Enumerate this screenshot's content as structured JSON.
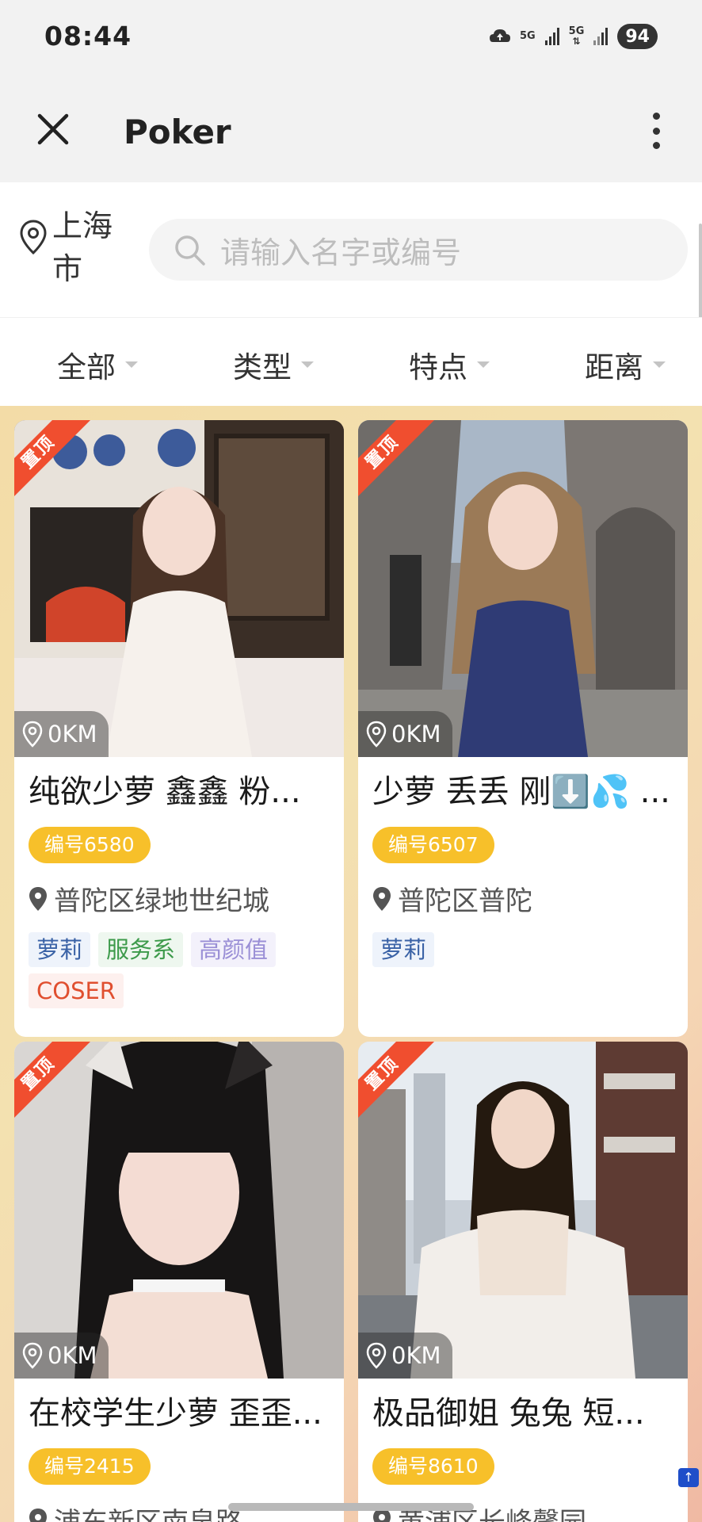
{
  "status_bar": {
    "time": "08:44",
    "net1": "5G",
    "net2": "5G",
    "battery": "94"
  },
  "app_bar": {
    "title": "Poker"
  },
  "search": {
    "city": "上海市",
    "placeholder": "请输入名字或编号"
  },
  "filters": [
    "全部",
    "类型",
    "特点",
    "距离"
  ],
  "cards": [
    {
      "ribbon": "置顶",
      "distance": "0KM",
      "title": "纯欲少萝 鑫鑫 粉...",
      "id": "编号6580",
      "location": "普陀区绿地世纪城",
      "tags": [
        "萝莉",
        "服务系",
        "高颜值",
        "COSER"
      ]
    },
    {
      "ribbon": "置顶",
      "distance": "0KM",
      "title": "少萝 丢丢 刚⬇️💦 ...",
      "id": "编号6507",
      "location": "普陀区普陀",
      "tags": [
        "萝莉"
      ]
    },
    {
      "ribbon": "置顶",
      "distance": "0KM",
      "title": "在校学生少萝 歪歪...",
      "id": "编号2415",
      "location": "浦东新区南泉路",
      "tags": []
    },
    {
      "ribbon": "置顶",
      "distance": "0KM",
      "title": "极品御姐 兔兔 短...",
      "id": "编号8610",
      "location": "黄浦区长峰馨园",
      "tags": []
    }
  ],
  "colors": {
    "accent": "#f7c02a",
    "ribbon": "#f04e2f"
  }
}
